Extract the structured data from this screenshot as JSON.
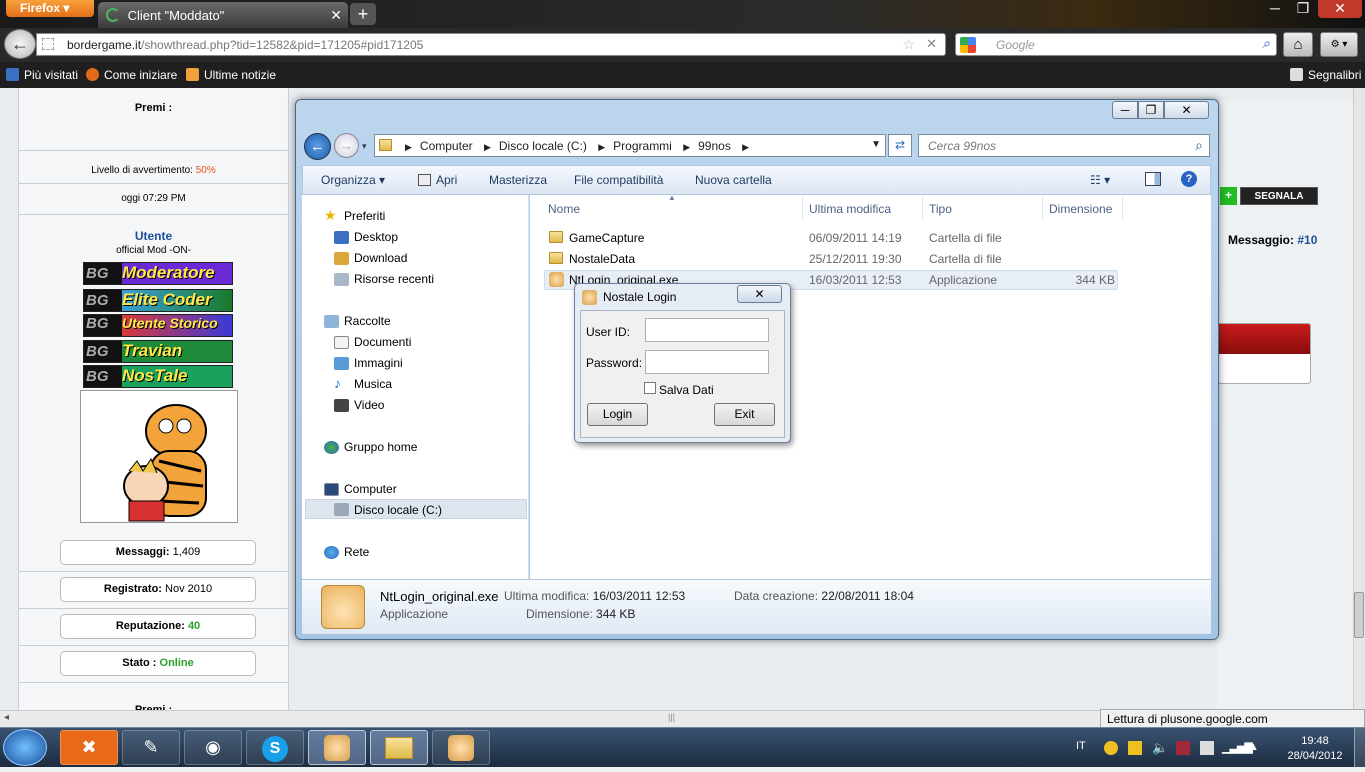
{
  "browser": {
    "menu_button": "Firefox",
    "tab_title": "Client \"Moddato\"",
    "url_domain": "bordergame.it",
    "url_path": "/showthread.php?tid=12582&pid=171205#pid171205",
    "search_placeholder": "Google",
    "bookmarks": [
      "Più visitati",
      "Come iniziare",
      "Ultime notizie"
    ],
    "bookmarks_right": "Segnalibri",
    "status_text": "Lettura di plusone.google.com"
  },
  "forum": {
    "premi_label_top": "Premi :",
    "warning_label": "Livello di avvertimento:",
    "warning_value": "50%",
    "post_time": "oggi 07:29 PM",
    "user_title": "Utente",
    "user_subtitle": "official Mod -ON-",
    "ranks": [
      "Moderatore",
      "Elite Coder",
      "Utente Storico",
      "Travian",
      "NosTale"
    ],
    "rank_prefix": "BG",
    "stats": [
      {
        "label": "Messaggi:",
        "value": "1,409"
      },
      {
        "label": "Registrato:",
        "value": "Nov 2010"
      },
      {
        "label": "Reputazione:",
        "value": "40"
      },
      {
        "label": "Stato :",
        "value": "Online"
      }
    ],
    "premi_label_bottom": "Premi :",
    "report_button": "SEGNALA",
    "message_label": "Messaggio:",
    "message_number": "#10"
  },
  "explorer": {
    "path": [
      "Computer",
      "Disco locale (C:)",
      "Programmi",
      "99nos"
    ],
    "search_placeholder": "Cerca 99nos",
    "commands": [
      "Organizza",
      "Apri",
      "Masterizza",
      "File compatibilità",
      "Nuova cartella"
    ],
    "nav": {
      "favorites_header": "Preferiti",
      "favorites": [
        "Desktop",
        "Download",
        "Risorse recenti"
      ],
      "libraries_header": "Raccolte",
      "libraries": [
        "Documenti",
        "Immagini",
        "Musica",
        "Video"
      ],
      "homegroup": "Gruppo home",
      "computer_header": "Computer",
      "computer_items": [
        "Disco locale (C:)"
      ],
      "network": "Rete"
    },
    "columns": [
      "Nome",
      "Ultima modifica",
      "Tipo",
      "Dimensione"
    ],
    "files": [
      {
        "name": "GameCapture",
        "modified": "06/09/2011 14:19",
        "type": "Cartella di file",
        "size": ""
      },
      {
        "name": "NostaleData",
        "modified": "25/12/2011 19:30",
        "type": "Cartella di file",
        "size": ""
      },
      {
        "name": "NtLogin_original.exe",
        "modified": "16/03/2011 12:53",
        "type": "Applicazione",
        "size": "344 KB"
      }
    ],
    "details": {
      "name": "NtLogin_original.exe",
      "kind": "Applicazione",
      "modified_label": "Ultima modifica:",
      "modified_value": "16/03/2011 12:53",
      "size_label": "Dimensione:",
      "size_value": "344 KB",
      "created_label": "Data creazione:",
      "created_value": "22/08/2011 18:04"
    }
  },
  "login_dialog": {
    "title": "Nostale Login",
    "user_label": "User ID:",
    "password_label": "Password:",
    "save_label": "Salva Dati",
    "login_button": "Login",
    "exit_button": "Exit"
  },
  "taskbar": {
    "language": "IT",
    "time": "19:48",
    "date": "28/04/2012"
  }
}
